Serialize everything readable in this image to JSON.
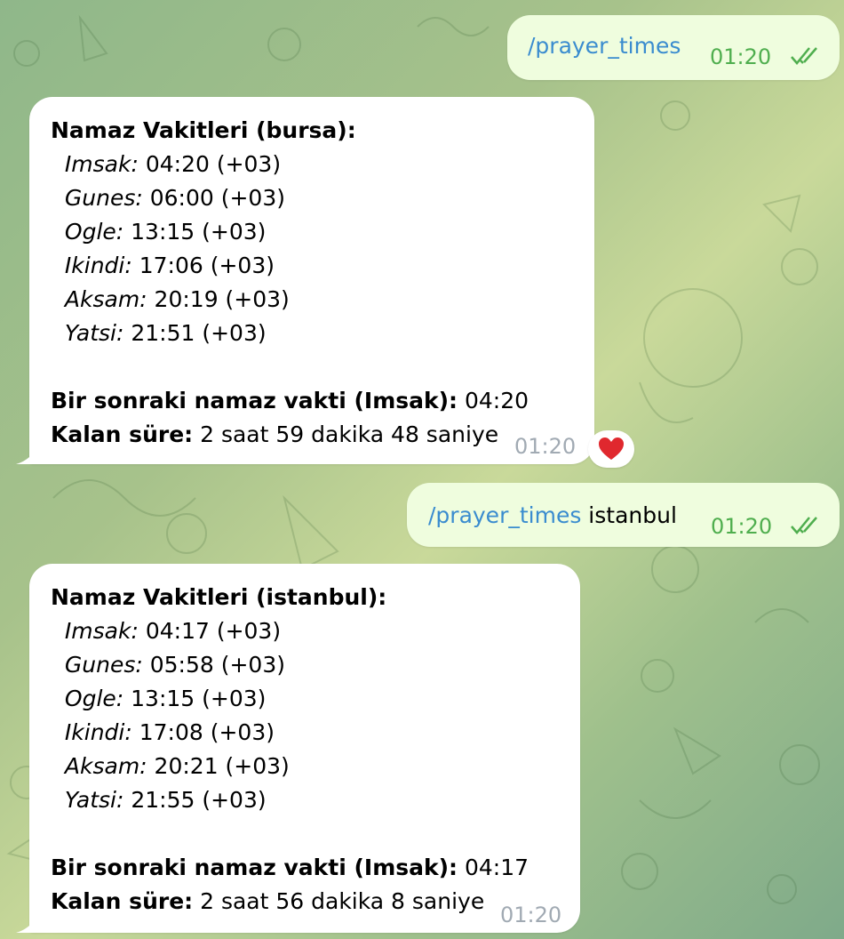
{
  "messages": [
    {
      "type": "outgoing",
      "command": "/prayer_times",
      "args": "",
      "time": "01:20"
    },
    {
      "type": "incoming",
      "title": "Namaz Vakitleri (bursa):",
      "times": [
        {
          "name": "Imsak:",
          "value": " 04:20 (+03)"
        },
        {
          "name": "Gunes:",
          "value": " 06:00 (+03)"
        },
        {
          "name": "Ogle:",
          "value": " 13:15 (+03)"
        },
        {
          "name": "Ikindi:",
          "value": " 17:06 (+03)"
        },
        {
          "name": "Aksam:",
          "value": " 20:19 (+03)"
        },
        {
          "name": "Yatsi:",
          "value": " 21:51 (+03)"
        }
      ],
      "next_label": "Bir sonraki namaz vakti (Imsak):",
      "next_value": " 04:20",
      "remaining_label": "Kalan süre:",
      "remaining_value": " 2 saat 59 dakika 48 saniye",
      "time": "01:20",
      "reaction": "heart-icon"
    },
    {
      "type": "outgoing",
      "command": "/prayer_times",
      "args": " istanbul",
      "time": "01:20"
    },
    {
      "type": "incoming",
      "title": "Namaz Vakitleri (istanbul):",
      "times": [
        {
          "name": "Imsak:",
          "value": " 04:17 (+03)"
        },
        {
          "name": "Gunes:",
          "value": " 05:58 (+03)"
        },
        {
          "name": "Ogle:",
          "value": " 13:15 (+03)"
        },
        {
          "name": "Ikindi:",
          "value": " 17:08 (+03)"
        },
        {
          "name": "Aksam:",
          "value": " 20:21 (+03)"
        },
        {
          "name": "Yatsi:",
          "value": " 21:55 (+03)"
        }
      ],
      "next_label": "Bir sonraki namaz vakti (Imsak):",
      "next_value": " 04:17",
      "remaining_label": "Kalan süre:",
      "remaining_value": " 2 saat 56 dakika 8 saniye",
      "time": "01:20"
    }
  ],
  "colors": {
    "outgoing_bubble": "#effdde",
    "incoming_bubble": "#ffffff",
    "command_link": "#3a8ccf",
    "outgoing_time": "#4fae4e",
    "incoming_time": "#a1aab3",
    "reaction_heart": "#e0282e"
  }
}
